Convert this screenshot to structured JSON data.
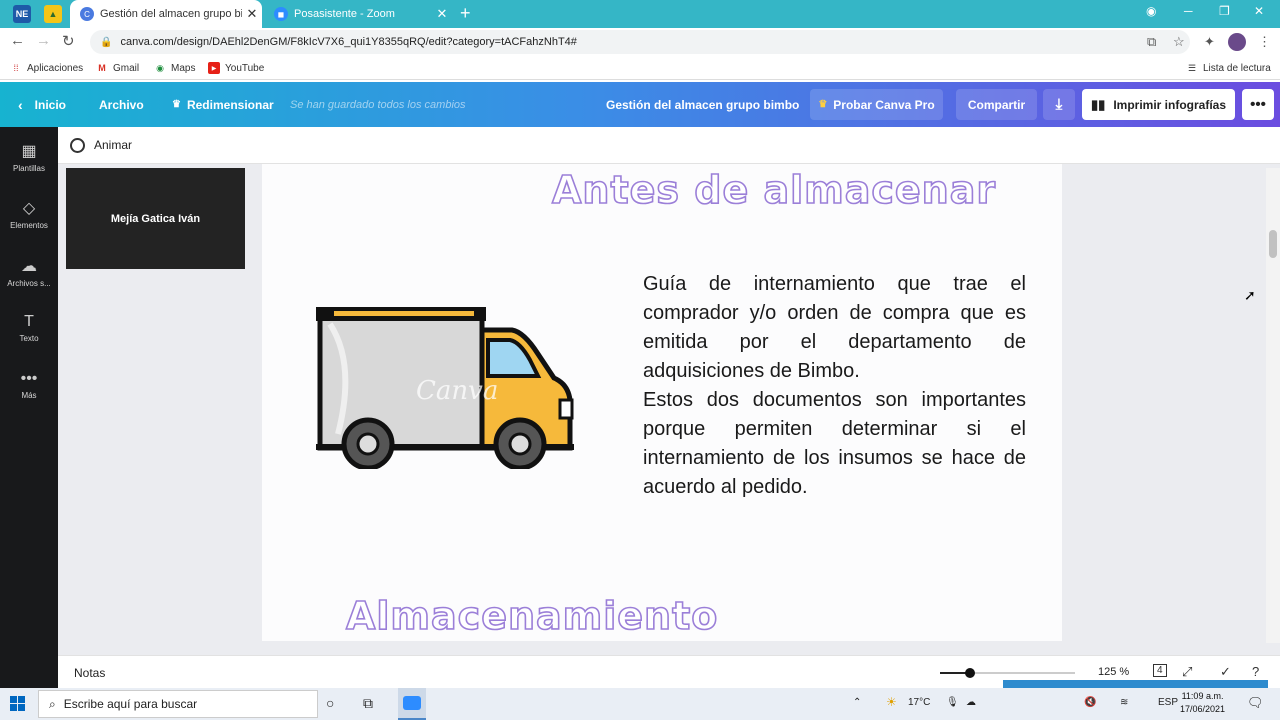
{
  "browser": {
    "pinned_tabs": [
      {
        "label": "NE",
        "icon": "ne-pinned-tab-icon"
      },
      {
        "label": "▲",
        "icon": "drive-pinned-tab-icon"
      }
    ],
    "tabs": [
      {
        "title": "Gestión del almacen grupo bimb",
        "favicon": "C",
        "favicon_color": "#4a7ae0",
        "close": "✕"
      },
      {
        "title": "Posasistente - Zoom",
        "favicon": "◼",
        "favicon_color": "#2d8cff",
        "close": "✕"
      }
    ],
    "new_tab": "+",
    "url": "canva.com/design/DAEhl2DenGM/F8kIcV7X6_qui1Y8355qRQ/edit?category=tACFahzNhT4#",
    "bookmarks": [
      {
        "label": "Aplicaciones"
      },
      {
        "label": "Gmail"
      },
      {
        "label": "Maps"
      },
      {
        "label": "YouTube"
      }
    ],
    "reading_list": "Lista de lectura"
  },
  "canva": {
    "home": "Inicio",
    "file": "Archivo",
    "resize": "Redimensionar",
    "saved_status": "Se han guardado todos los cambios",
    "design_title": "Gestión del almacen grupo bimbo",
    "try_pro": "Probar Canva Pro",
    "share": "Compartir",
    "print": "Imprimir infografías",
    "more": "•••",
    "sidebar": [
      {
        "label": "Plantillas",
        "icon": "▦"
      },
      {
        "label": "Elementos",
        "icon": "◇"
      },
      {
        "label": "Archivos s...",
        "icon": "☁"
      },
      {
        "label": "Texto",
        "icon": "T"
      },
      {
        "label": "Más",
        "icon": "•••"
      }
    ],
    "animate": "Animar",
    "video_participant": "Mejía Gatica Iván",
    "notes": "Notas",
    "zoom_level": "125 %",
    "zoom_level_fraction": 0.22,
    "page_count": "4"
  },
  "design": {
    "heading1": "Antes de almacenar",
    "body_paragraphs": [
      "Guía de internamiento que trae el comprador y/o orden de compra que es emitida por el departamento de adquisiciones de Bimbo.",
      "Estos dos documentos son importantes porque permiten determinar si el internamiento de los insumos se hace de acuerdo al pedido."
    ],
    "watermark": "Canva",
    "heading2": "Almacenamiento"
  },
  "taskbar": {
    "search_placeholder": "Escribe aquí para buscar",
    "temperature": "17°C",
    "language": "ESP",
    "time": "11:09 a.m.",
    "date": "17/06/2021"
  },
  "colors": {
    "heading_outline": "#9b7fd8",
    "truck_body": "#f6b93b",
    "canva_gradient_start": "#17b3d0",
    "canva_gradient_end": "#6b4de0"
  }
}
